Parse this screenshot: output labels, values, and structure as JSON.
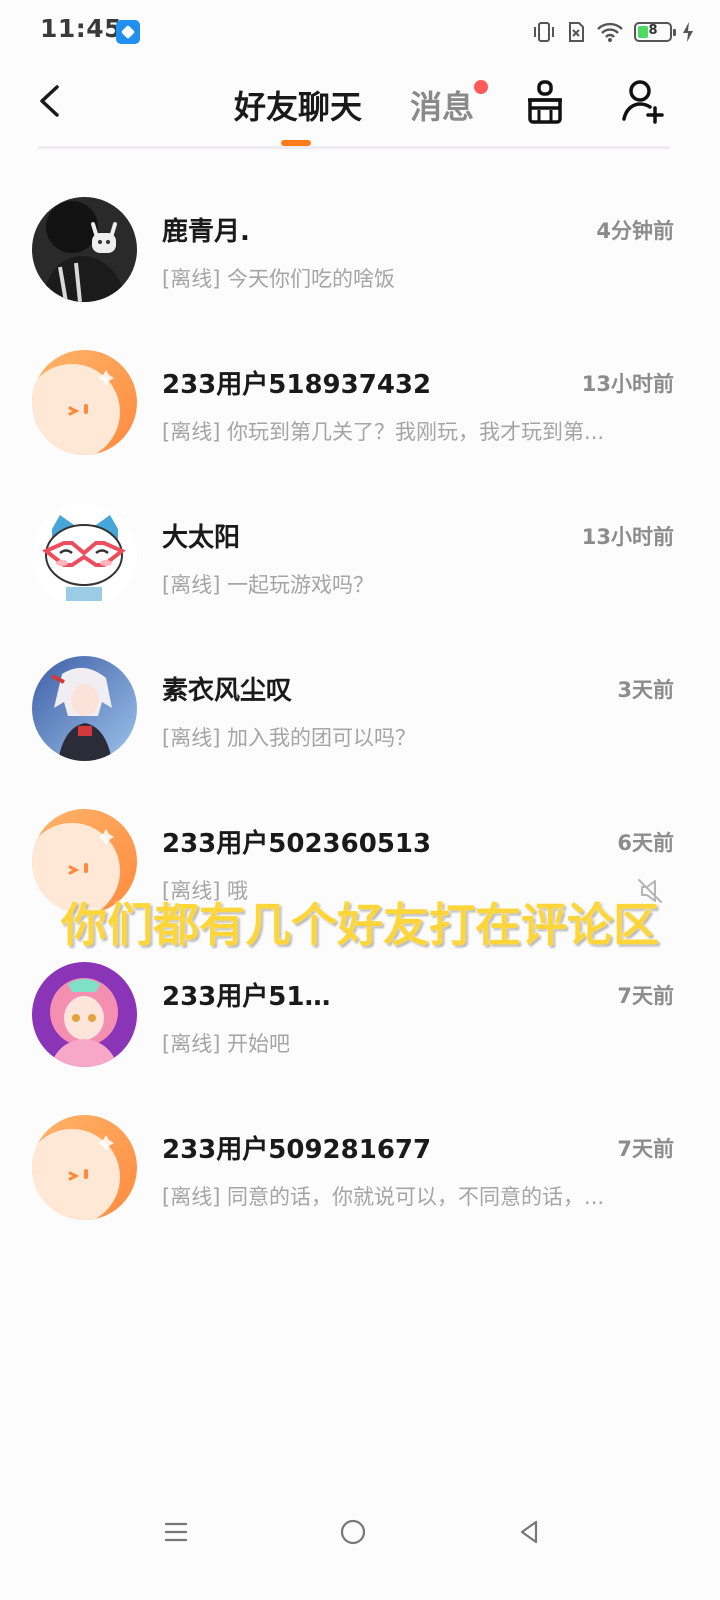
{
  "status_bar": {
    "time": "11:45",
    "battery": "8"
  },
  "nav": {
    "tab_friends": "好友聊天",
    "tab_messages": "消息",
    "accent_color": "#ff7a1a",
    "unread_dot_color": "#ff5a5a"
  },
  "chats": [
    {
      "name": "鹿青月.",
      "time": "4分钟前",
      "preview": "[离线] 今天你们吃的啥饭",
      "avatar": "photo-avatar",
      "muted": false
    },
    {
      "name": "233用户518937432",
      "time": "13小时前",
      "preview": "[离线] 你玩到第几关了？我刚玩，我才玩到第...",
      "avatar": "default-avatar",
      "muted": false
    },
    {
      "name": "大太阳",
      "time": "13小时前",
      "preview": "[离线] 一起玩游戏吗？",
      "avatar": "cat-avatar",
      "muted": false
    },
    {
      "name": "素衣风尘叹",
      "time": "3天前",
      "preview": "[离线] 加入我的团可以吗？",
      "avatar": "anime-avatar",
      "muted": false
    },
    {
      "name": "233用户502360513",
      "time": "6天前",
      "preview": "[离线] 哦",
      "avatar": "default-avatar",
      "muted": true
    },
    {
      "name": "233用户51…",
      "time": "7天前",
      "preview": "[离线] 开始吧",
      "avatar": "anime-girl-avatar",
      "muted": false
    },
    {
      "name": "233用户509281677",
      "time": "7天前",
      "preview": "[离线] 同意的话，你就说可以，不同意的话，...",
      "avatar": "default-avatar",
      "muted": false
    }
  ],
  "overlay_caption": "你们都有几个好友打在评论区"
}
